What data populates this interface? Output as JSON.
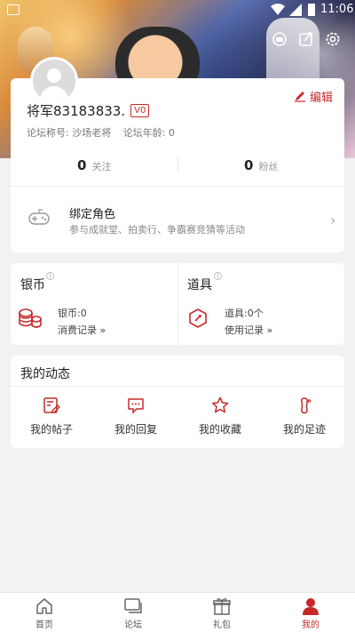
{
  "status_bar": {
    "time": "11:06"
  },
  "profile": {
    "username": "将军83183833.",
    "level": "V0",
    "title_label": "论坛称号: 沙场老将",
    "age_label": "论坛年龄: 0",
    "edit_label": "编辑",
    "following_count": "0",
    "following_label": "关注",
    "fans_count": "0",
    "fans_label": "粉丝"
  },
  "bind_role": {
    "title": "绑定角色",
    "subtitle": "参与成就堂、拍卖行、争霸赛竞猜等活动"
  },
  "wallet": {
    "silver_title": "银币",
    "silver_value": "银币:0",
    "silver_link": "消费记录 »",
    "items_title": "道具",
    "items_value": "道具:0个",
    "items_link": "使用记录 »"
  },
  "activity": {
    "title": "我的动态",
    "items": [
      {
        "label": "我的帖子",
        "icon": "post-icon"
      },
      {
        "label": "我的回复",
        "icon": "reply-icon"
      },
      {
        "label": "我的收藏",
        "icon": "star-icon"
      },
      {
        "label": "我的足迹",
        "icon": "footprint-icon"
      }
    ]
  },
  "bottom_nav": {
    "items": [
      {
        "label": "首页",
        "icon": "home-icon"
      },
      {
        "label": "论坛",
        "icon": "forum-icon"
      },
      {
        "label": "礼包",
        "icon": "gift-icon"
      },
      {
        "label": "我的",
        "icon": "profile-icon"
      }
    ],
    "active": "我的"
  },
  "colors": {
    "accent": "#c62828",
    "background": "#f2f2f4"
  }
}
